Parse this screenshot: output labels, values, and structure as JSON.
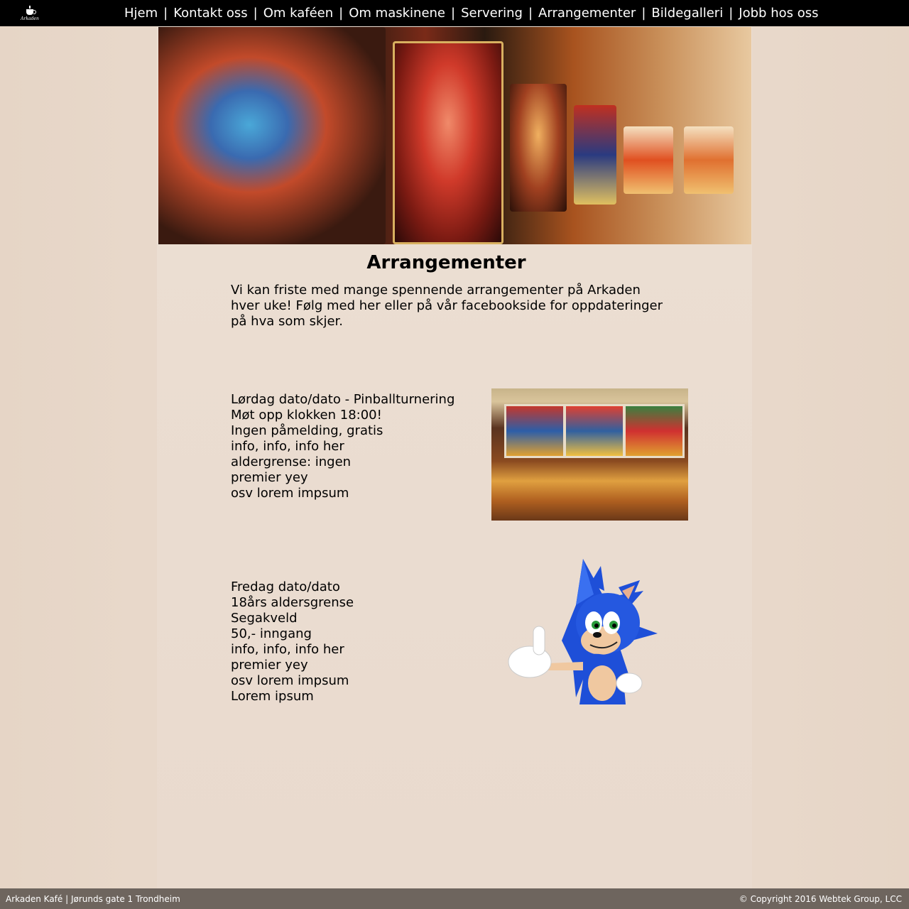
{
  "header": {
    "logo_text": "Arkaden",
    "nav": [
      {
        "label": "Hjem"
      },
      {
        "label": "Kontakt oss"
      },
      {
        "label": "Om kaféen"
      },
      {
        "label": "Om maskinene"
      },
      {
        "label": "Servering"
      },
      {
        "label": "Arrangementer"
      },
      {
        "label": "Bildegalleri"
      },
      {
        "label": "Jobb hos oss"
      }
    ],
    "separator": "|"
  },
  "main": {
    "title": "Arrangementer",
    "intro": "Vi kan friste med mange spennende arrangementer på Arkaden hver uke! Følg med her eller på vår facebookside for oppdateringer på hva som skjer.",
    "events": [
      {
        "lines": [
          "Lørdag dato/dato - Pinballturnering",
          "Møt opp klokken 18:00!",
          "Ingen påmelding, gratis",
          "info, info, info her",
          "aldergrense: ingen",
          "premier yey",
          "osv lorem impsum"
        ]
      },
      {
        "lines": [
          "Fredag dato/dato",
          "18års aldersgrense",
          "Segakveld",
          "50,- inngang",
          "info, info, info her",
          "premier yey",
          "osv lorem impsum",
          "Lorem ipsum"
        ]
      }
    ]
  },
  "footer": {
    "left": "Arkaden Kafé | Jørunds gate 1 Trondheim",
    "right": "© Copyright 2016 Webtek Group, LCC"
  },
  "colors": {
    "topbar": "#000000",
    "footer": "#6e655e",
    "page_bg": "#e8d9cc"
  }
}
